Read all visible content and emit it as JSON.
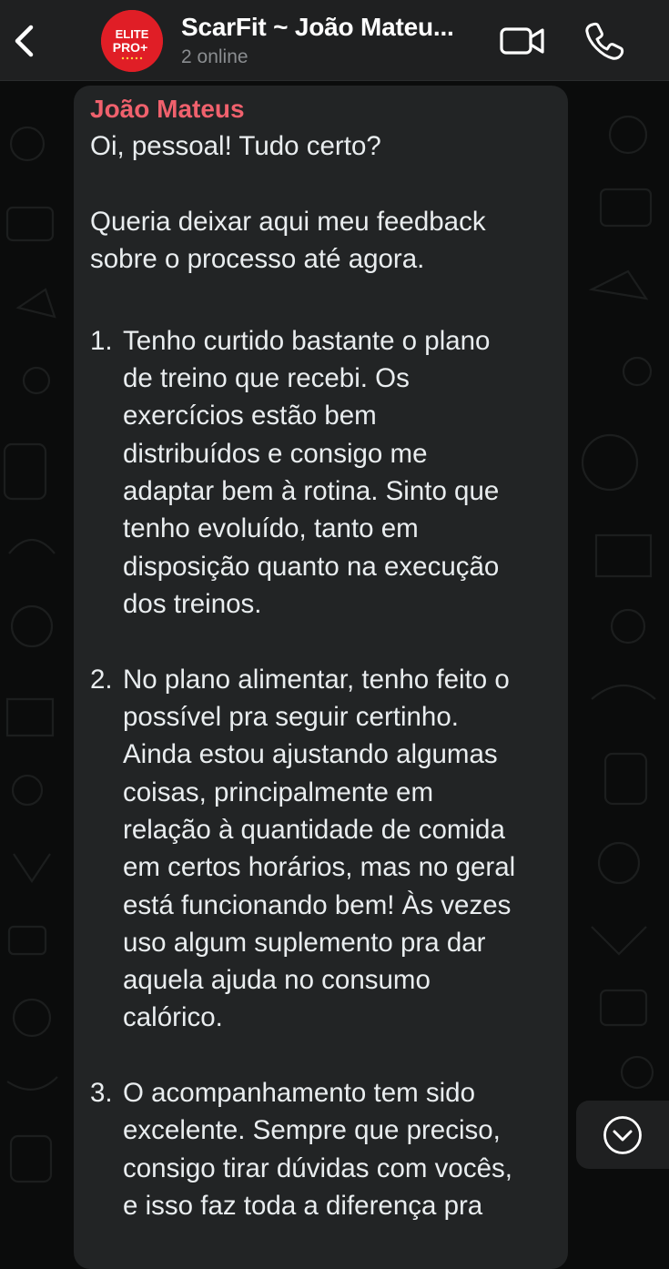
{
  "header": {
    "title": "ScarFit ~ João Mateu...",
    "subtitle": "2 online",
    "avatar_text_line1": "ELITE",
    "avatar_text_line2": "PRO+"
  },
  "message": {
    "sender": "João Mateus",
    "greeting": "Oi, pessoal! Tudo certo?",
    "intro_line1": "Queria deixar aqui meu feedback",
    "intro_line2": "sobre o processo até agora.",
    "items": [
      {
        "number": "1.",
        "lines": [
          "Tenho curtido bastante o plano",
          "de treino que recebi. Os",
          "exercícios estão bem",
          "distribuídos e consigo me",
          "adaptar bem à rotina. Sinto que",
          "tenho evoluído, tanto em",
          "disposição quanto na execução",
          "dos treinos."
        ]
      },
      {
        "number": "2.",
        "lines": [
          "No plano alimentar, tenho feito o",
          "possível pra seguir certinho.",
          "Ainda estou ajustando algumas",
          "coisas, principalmente em",
          "relação à quantidade de comida",
          "em certos horários, mas no geral",
          "está funcionando bem! Às vezes",
          "uso algum suplemento pra dar",
          "aquela ajuda no consumo",
          "calórico."
        ]
      },
      {
        "number": "3.",
        "lines": [
          "O acompanhamento tem sido",
          "excelente. Sempre que preciso,",
          "consigo tirar dúvidas com vocês,",
          "e isso faz toda a diferença pra"
        ]
      }
    ]
  },
  "colors": {
    "header_bg": "#1f2021",
    "bubble_bg": "#222425",
    "sender": "#f0616d",
    "text": "#e9edef",
    "avatar_bg": "#e01e26"
  },
  "icons": {
    "back": "chevron-left-icon",
    "video": "video-camera-icon",
    "call": "phone-icon",
    "scroll": "chevron-down-circle-icon"
  }
}
